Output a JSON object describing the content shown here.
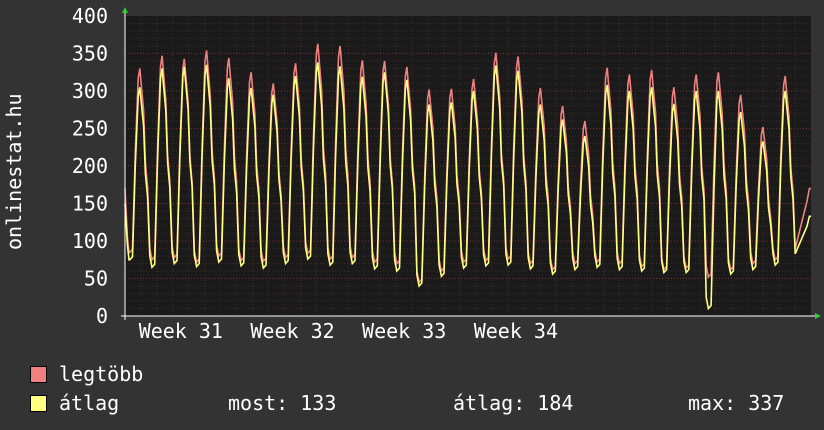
{
  "chart_data": {
    "type": "line",
    "ylabel": "onlinestat.hu",
    "ylim": [
      0,
      400
    ],
    "y_ticks": [
      0,
      50,
      100,
      150,
      200,
      250,
      300,
      350,
      400
    ],
    "x_tick_labels": [
      "Week 31",
      "Week 32",
      "Week 33",
      "Week 34"
    ],
    "grid": true,
    "x_range_days": [
      0,
      43
    ],
    "x_tick_positions_days": [
      3.5,
      10.5,
      17.5,
      24.5
    ],
    "daily_peaks_max": [
      330,
      347,
      343,
      354,
      344,
      325,
      310,
      337,
      363,
      360,
      341,
      340,
      332,
      302,
      303,
      316,
      351,
      346,
      304,
      280,
      260,
      331,
      322,
      328,
      305,
      322,
      325,
      295,
      252,
      320
    ],
    "daily_peaks_avg": [
      305,
      330,
      332,
      335,
      317,
      304,
      295,
      320,
      338,
      333,
      319,
      325,
      315,
      282,
      285,
      300,
      334,
      327,
      282,
      262,
      240,
      308,
      300,
      305,
      283,
      300,
      300,
      272,
      233,
      300
    ],
    "daily_lows_max": [
      85,
      75,
      78,
      72,
      80,
      74,
      73,
      78,
      84,
      76,
      78,
      72,
      70,
      45,
      60,
      72,
      74,
      76,
      70,
      62,
      70,
      72,
      70,
      66,
      62,
      64,
      52,
      62,
      70,
      75
    ],
    "daily_lows_avg": [
      75,
      65,
      70,
      66,
      72,
      67,
      64,
      70,
      76,
      68,
      70,
      63,
      60,
      40,
      53,
      64,
      67,
      68,
      63,
      56,
      62,
      65,
      62,
      60,
      58,
      58,
      10,
      56,
      62,
      68
    ],
    "series": [
      {
        "name": "legtöbb",
        "color": "#f08080"
      },
      {
        "name": "átlag",
        "color": "#ffff80"
      }
    ]
  },
  "legend": {
    "max_label": "legtöbb",
    "avg_label": "átlag"
  },
  "stats": {
    "now": "most: 133",
    "avg": "átlag: 184",
    "max": "max: 337"
  },
  "colors": {
    "background": "#333333",
    "plot_background": "#1a1a1a",
    "grid": "#6a3030",
    "axis_text": "#ffffff"
  }
}
